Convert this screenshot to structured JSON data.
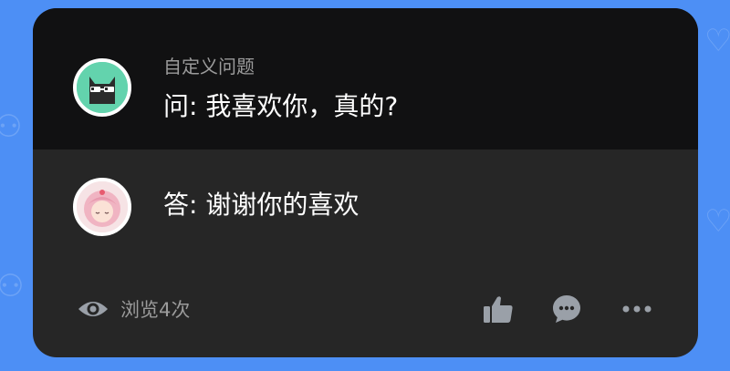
{
  "question": {
    "label": "自定义问题",
    "text": "问: 我喜欢你，真的?"
  },
  "answer": {
    "text": "答: 谢谢你的喜欢"
  },
  "footer": {
    "views_label": "浏览4次"
  },
  "colors": {
    "background": "#4d8ff5",
    "card": "#262626",
    "question_band": "#111112",
    "icon": "#9aa0a8",
    "muted_text": "#9b9b9b"
  },
  "icons": [
    "eye-icon",
    "thumbs-up-icon",
    "comment-icon",
    "more-icon"
  ]
}
